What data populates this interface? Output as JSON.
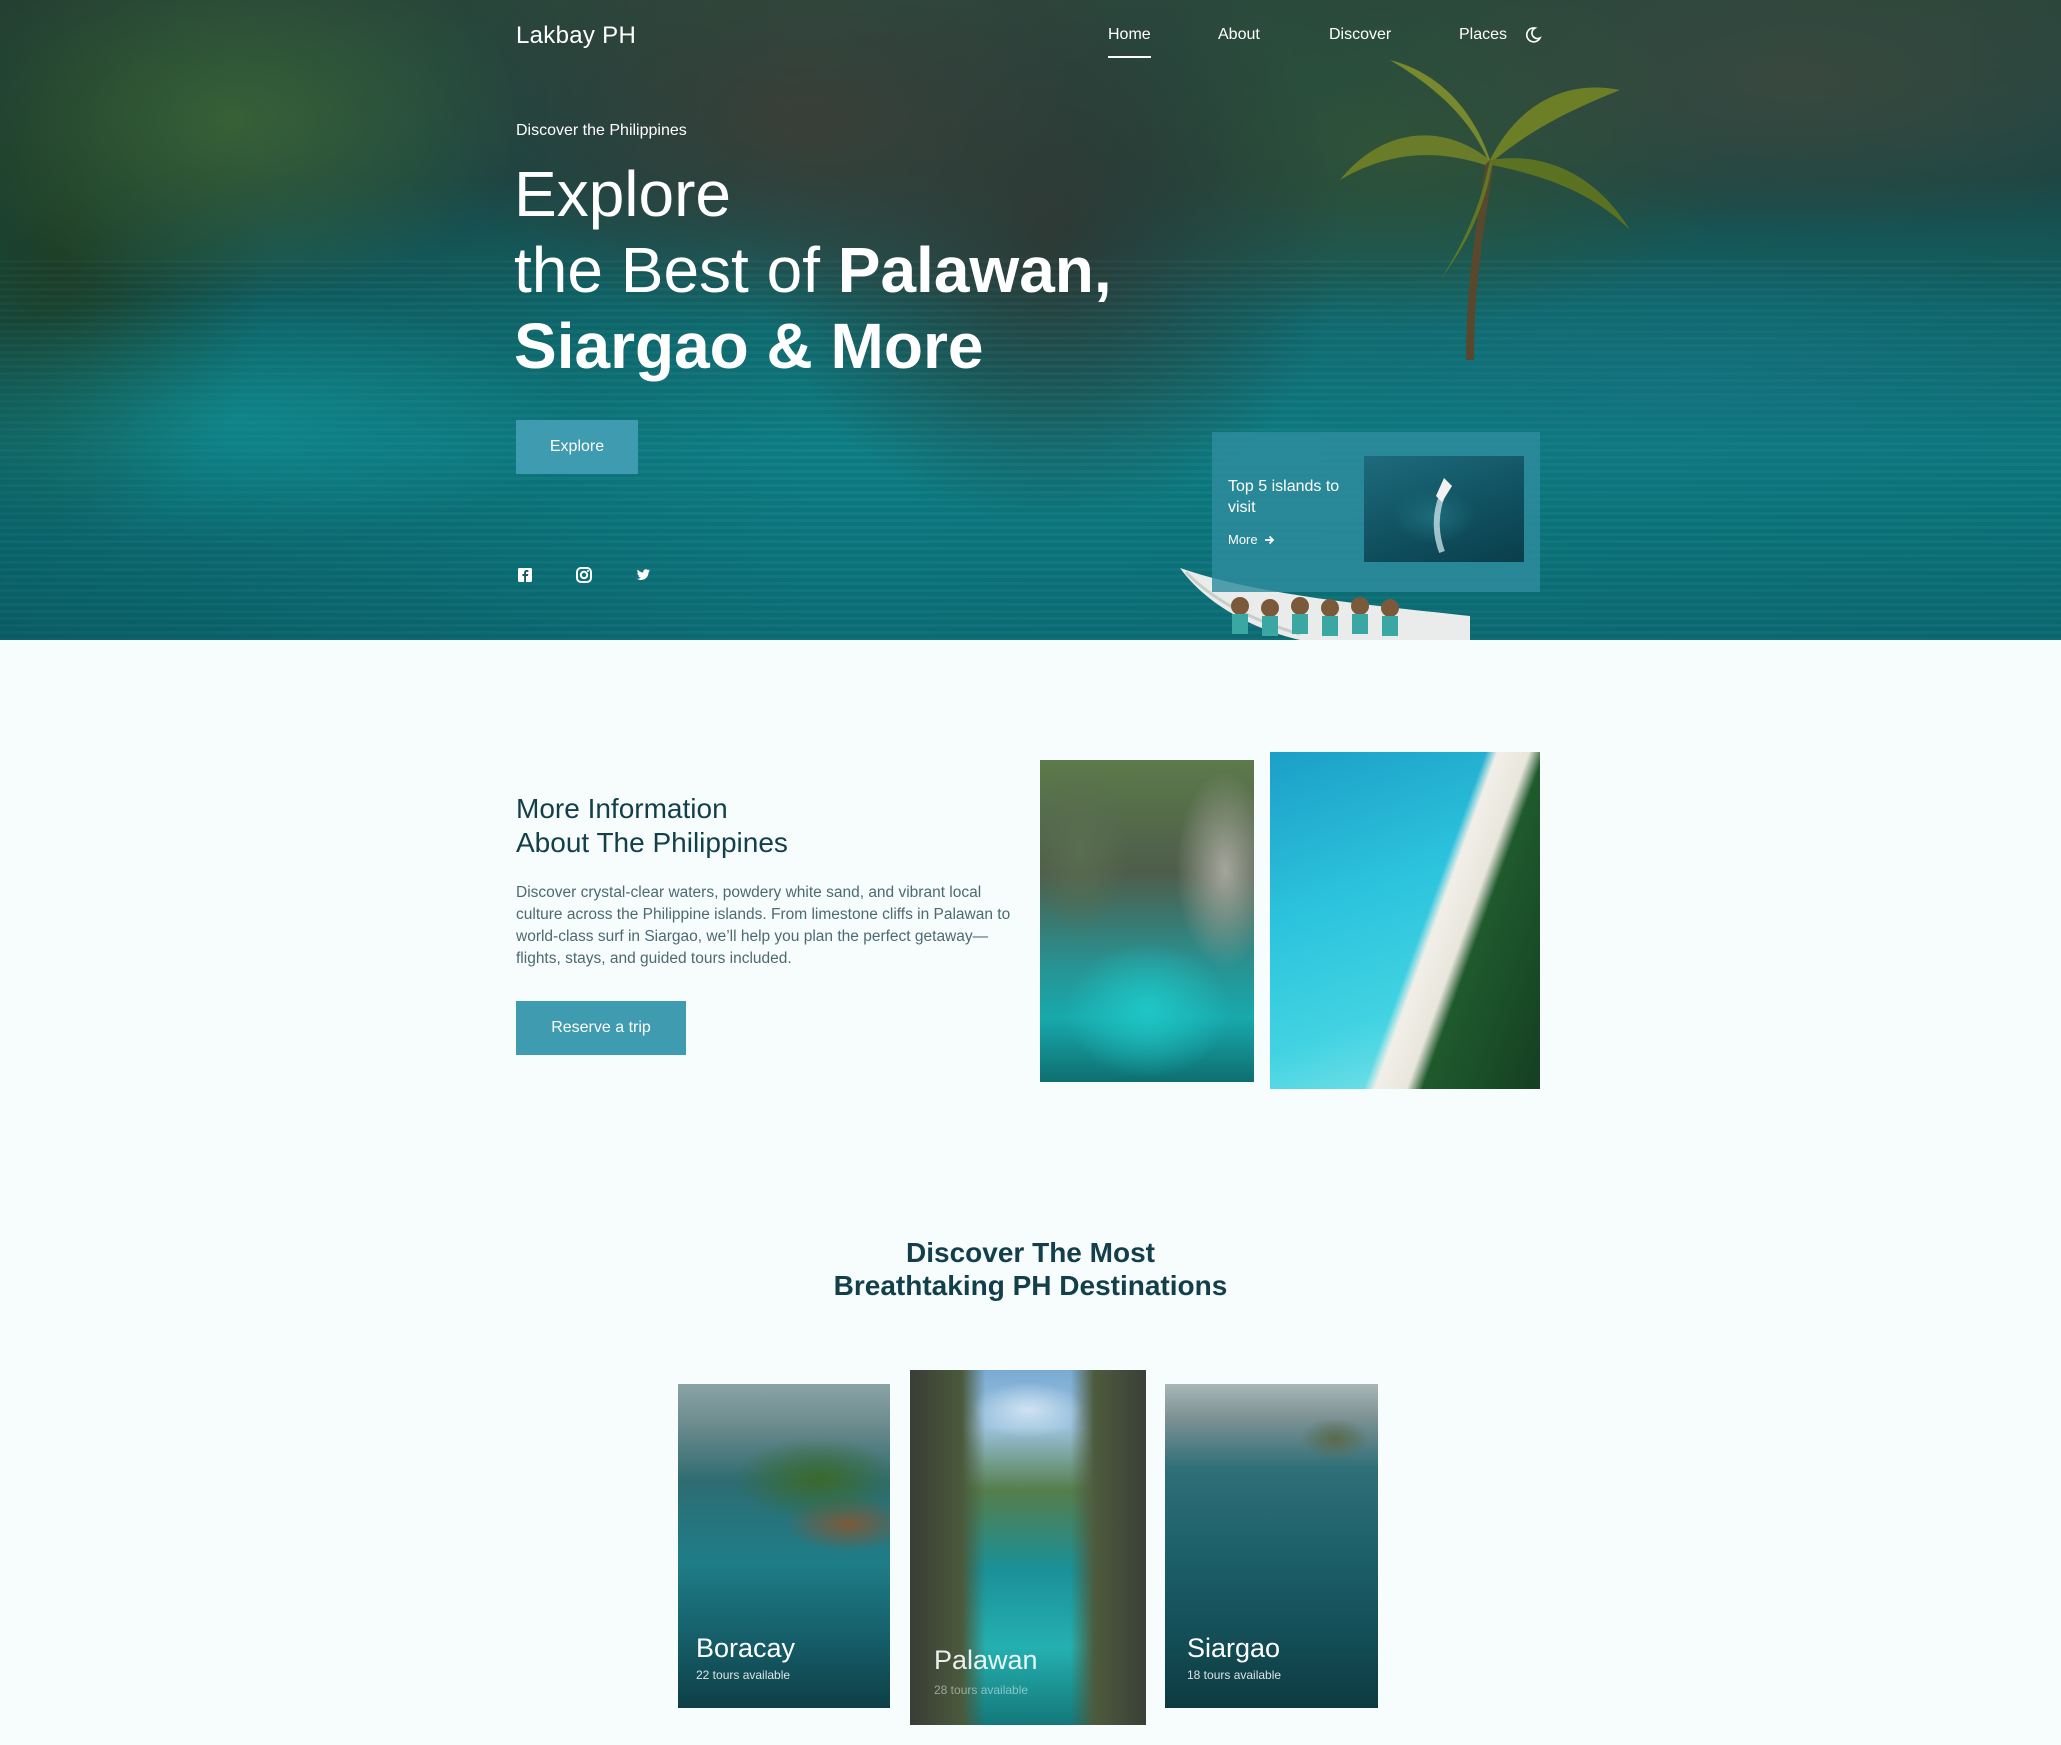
{
  "brand": "Lakbay PH",
  "nav": {
    "links": [
      {
        "label": "Home",
        "active": true
      },
      {
        "label": "About",
        "active": false
      },
      {
        "label": "Discover",
        "active": false
      },
      {
        "label": "Places",
        "active": false
      }
    ],
    "theme_icon": "moon-icon"
  },
  "hero": {
    "eyebrow": "Discover the Philippines",
    "title_line1": "Explore",
    "title_line2_light": "the Best of ",
    "title_line2_bold": "Palawan,",
    "title_line3_bold": "Siargao & More",
    "cta": "Explore",
    "socials": [
      "facebook-icon",
      "instagram-icon",
      "twitter-icon"
    ]
  },
  "promo": {
    "title": "Top 5 islands to visit",
    "link": "More"
  },
  "info": {
    "title_line1": "More Information",
    "title_line2": "About The Philippines",
    "body": "Discover crystal-clear waters, powdery white sand, and vibrant local culture across the Philippine islands. From limestone cliffs in Palawan to world-class surf in Siargao, we’ll help you plan the perfect getaway—flights, stays, and guided tours included.",
    "cta": "Reserve a trip"
  },
  "destinations": {
    "title_line1": "Discover The Most",
    "title_line2": "Breathtaking PH Destinations",
    "cards": [
      {
        "name": "Boracay",
        "tours": "22 tours available"
      },
      {
        "name": "Palawan",
        "tours": "28 tours available"
      },
      {
        "name": "Siargao",
        "tours": "18 tours available"
      }
    ]
  },
  "colors": {
    "accent": "#3f9bb0",
    "heading": "#123f4a",
    "background": "#f7fcfc"
  }
}
